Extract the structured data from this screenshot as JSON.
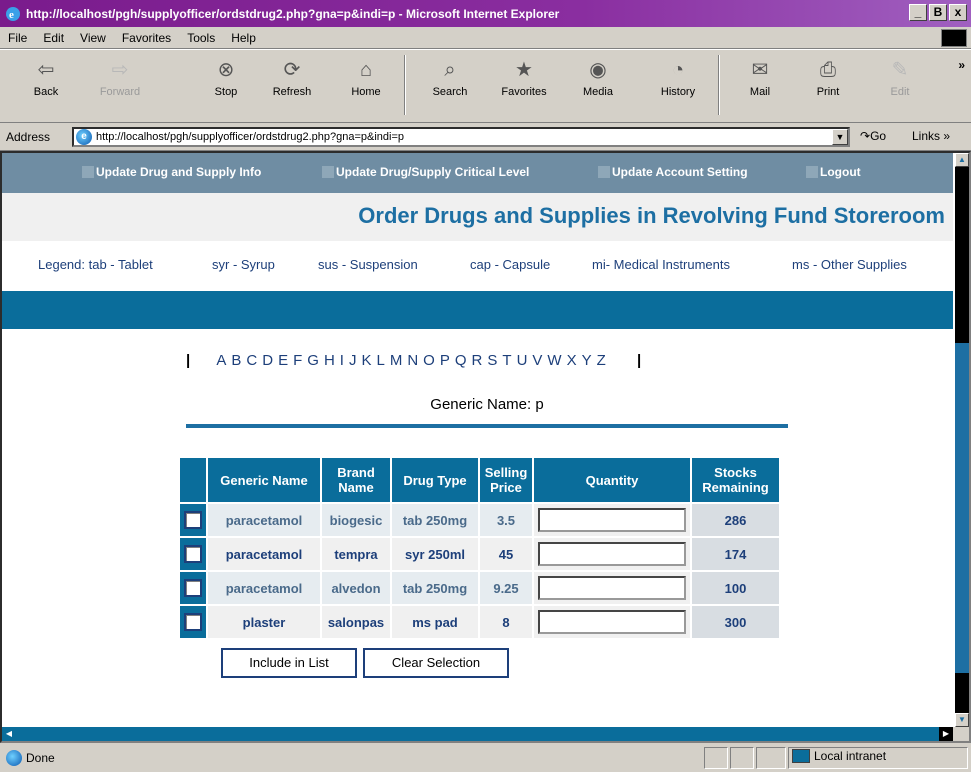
{
  "window": {
    "title": "http://localhost/pgh/supplyofficer/ordstdrug2.php?gna=p&indi=p - Microsoft Internet Explorer",
    "minimize": "_",
    "maximize": "B",
    "close": "x"
  },
  "menu": [
    "File",
    "Edit",
    "View",
    "Favorites",
    "Tools",
    "Help"
  ],
  "toolbar": {
    "back": "Back",
    "forward": "Forward",
    "stop": "Stop",
    "refresh": "Refresh",
    "home": "Home",
    "search": "Search",
    "favorites": "Favorites",
    "media": "Media",
    "history": "History",
    "mail": "Mail",
    "print": "Print",
    "edit": "Edit",
    "more": "»"
  },
  "address": {
    "label": "Address",
    "url": "http://localhost/pgh/supplyofficer/ordstdrug2.php?gna=p&indi=p",
    "go": "Go",
    "links": "Links »"
  },
  "nav": {
    "item1": "Update Drug and Supply Info",
    "item2": "Update Drug/Supply Critical Level",
    "item3": "Update Account Setting",
    "item4": "Logout"
  },
  "page_title": "Order Drugs and Supplies in Revolving Fund Storeroom",
  "legend": {
    "tab": "Legend: tab - Tablet",
    "syr": "syr - Syrup",
    "sus": "sus - Suspension",
    "cap": "cap - Capsule",
    "mi": "mi- Medical Instruments",
    "ms": "ms - Other Supplies"
  },
  "alphabet": [
    "A",
    "B",
    "C",
    "D",
    "E",
    "F",
    "G",
    "H",
    "I",
    "J",
    "K",
    "L",
    "M",
    "N",
    "O",
    "P",
    "Q",
    "R",
    "S",
    "T",
    "U",
    "V",
    "W",
    "X",
    "Y",
    "Z"
  ],
  "generic_name_label": "Generic Name: p",
  "table": {
    "headers": {
      "generic": "Generic Name",
      "brand": "Brand Name",
      "type": "Drug Type",
      "price": "Selling Price",
      "quantity": "Quantity",
      "stocks": "Stocks Remaining"
    },
    "rows": [
      {
        "generic": "paracetamol",
        "brand": "biogesic",
        "type": "tab 250mg",
        "price": "3.5",
        "stocks": "286"
      },
      {
        "generic": "paracetamol",
        "brand": "tempra",
        "type": "syr 250ml",
        "price": "45",
        "stocks": "174"
      },
      {
        "generic": "paracetamol",
        "brand": "alvedon",
        "type": "tab 250mg",
        "price": "9.25",
        "stocks": "100"
      },
      {
        "generic": "plaster",
        "brand": "salonpas",
        "type": "ms pad",
        "price": "8",
        "stocks": "300"
      }
    ]
  },
  "buttons": {
    "include": "Include in List",
    "clear": "Clear Selection"
  },
  "status": {
    "text": "Done",
    "zone": "Local intranet"
  }
}
